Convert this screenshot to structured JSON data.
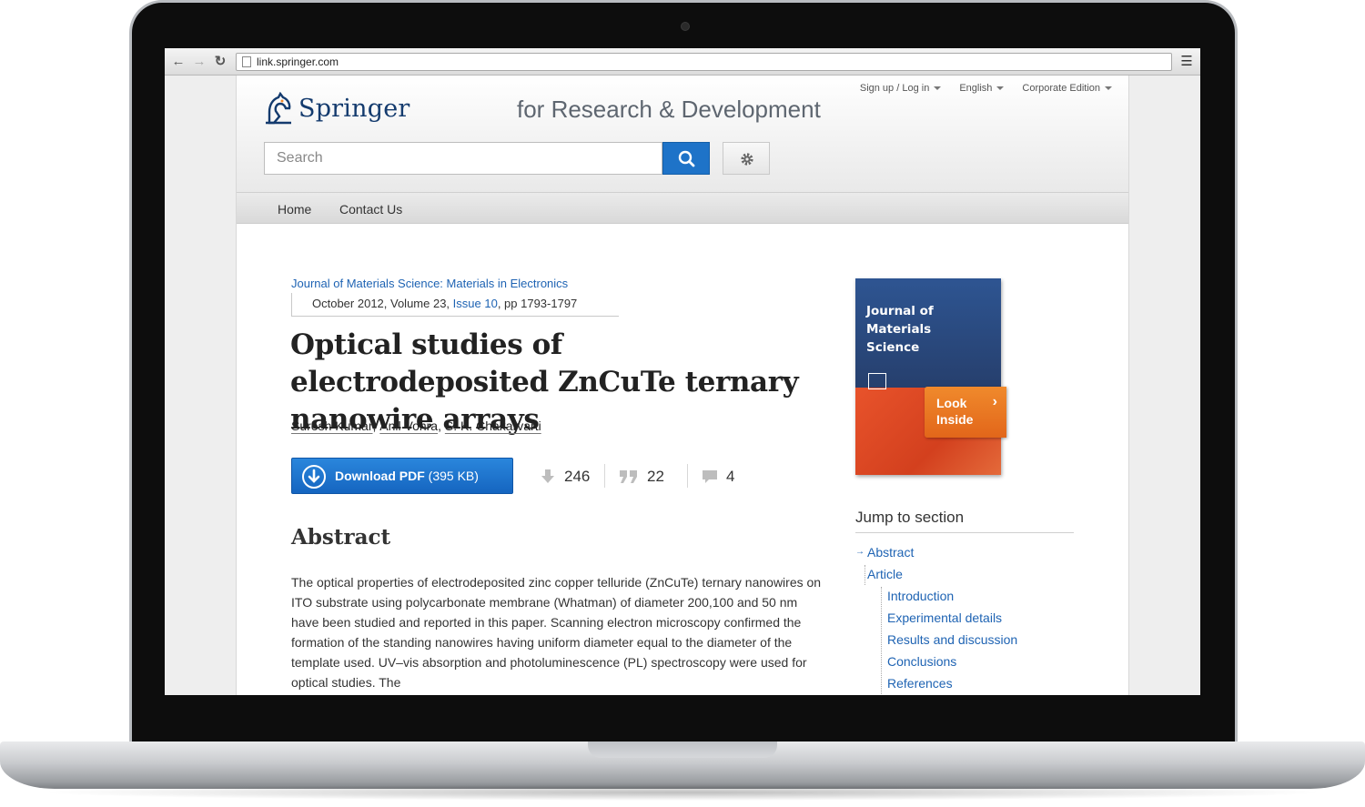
{
  "browser": {
    "url": "link.springer.com",
    "icons": {
      "back": "arrow-left-icon",
      "forward": "arrow-right-icon",
      "reload": "reload-icon",
      "menu": "hamburger-menu-icon"
    }
  },
  "header": {
    "logo_text": "Springer",
    "tagline": "for Research & Development",
    "top_links": [
      "Sign up / Log in",
      "English",
      "Corporate Edition"
    ],
    "search_placeholder": "Search"
  },
  "nav": [
    "Home",
    "Contact Us"
  ],
  "article": {
    "journal": "Journal of Materials Science: Materials in Electronics",
    "issue_date": "October 2012, Volume 23, ",
    "issue_link": "Issue 10",
    "pages": ", pp 1793-1797",
    "title": "Optical studies of electrodeposited ZnCuTe ternary nanowire arrays",
    "authors": [
      "Suresh Kumar",
      "Anil Vohra",
      "S. K. Chakarvarti"
    ],
    "download_label": "Download PDF",
    "download_size": "(395 KB)",
    "metrics": {
      "downloads": "246",
      "citations": "22",
      "comments": "4"
    },
    "abstract_heading": "Abstract",
    "abstract_text": "The optical properties of electrodeposited zinc copper telluride (ZnCuTe) ternary nanowires on ITO substrate using polycarbonate membrane (Whatman) of diameter 200,100 and 50 nm have been studied and reported in this paper. Scanning electron microscopy confirmed the formation of the standing nanowires having uniform diameter equal to the diameter of the template used. UV–vis absorption and photoluminescence (PL) spectroscopy were used for optical studies. The"
  },
  "sidebar": {
    "cover_title": "Journal of Materials Science",
    "look_inside": "Look Inside",
    "jump_heading": "Jump to section",
    "sections": [
      "Abstract",
      "Article",
      "Introduction",
      "Experimental details",
      "Results and discussion",
      "Conclusions",
      "References"
    ]
  },
  "colors": {
    "link": "#1e63b3",
    "primary_button": "#1e73c8",
    "look_inside": "#e8731e"
  }
}
